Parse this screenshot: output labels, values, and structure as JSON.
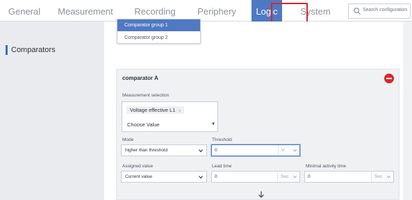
{
  "nav": {
    "tabs": [
      {
        "label": "General",
        "active": false
      },
      {
        "label": "Measurement",
        "active": false
      },
      {
        "label": "Recording",
        "active": false
      },
      {
        "label": "Periphery",
        "active": false
      },
      {
        "label": "Logic",
        "active": true
      },
      {
        "label": "System",
        "active": false
      }
    ],
    "search_placeholder": "Search configuration",
    "search_icon": "search-icon"
  },
  "sidebar": {
    "items": [
      {
        "label": "Comparators",
        "active": true
      }
    ]
  },
  "dropdown": {
    "items": [
      {
        "label": "Comparator group 1",
        "selected": true
      },
      {
        "label": "Comparator group 2",
        "selected": false
      }
    ]
  },
  "card": {
    "title": "comparator A",
    "remove_icon": "remove-circle-icon",
    "measurement": {
      "label": "Measurement selection",
      "selected_chip": "Voltage effective L1",
      "chip_remove": "x",
      "placeholder": "Choose Value"
    },
    "mode": {
      "label": "Mode",
      "value": "higher than threshold"
    },
    "threshold": {
      "label": "Threshold",
      "value": "0",
      "unit": "V"
    },
    "assigned": {
      "label": "Assigned value",
      "value": "Current value"
    },
    "lead_time": {
      "label": "Lead time",
      "value": "0",
      "unit": "Sec"
    },
    "min_activity": {
      "label": "Minimal activity time",
      "value": "0",
      "unit": "Sec"
    }
  },
  "footer": {
    "down_icon": "arrow-down-icon"
  },
  "colors": {
    "accent": "#4f79c2",
    "highlight": "#d8262e",
    "remove": "#d8262e"
  }
}
